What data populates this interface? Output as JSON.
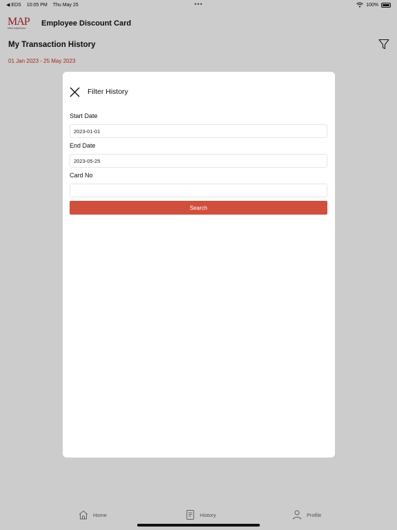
{
  "status_bar": {
    "back_label": "◀ EDS",
    "time": "10:05 PM",
    "date": "Thu May 25",
    "battery": "100%"
  },
  "header": {
    "logo_text": "MAP",
    "logo_subtext": "Mitra Adiperkasa",
    "app_title": "Employee Discount Card",
    "page_title": "My Transaction History",
    "date_range": "01 Jan 2023 - 25 May 2023"
  },
  "modal": {
    "title": "Filter History",
    "start_date_label": "Start Date",
    "start_date_value": "2023-01-01",
    "end_date_label": "End Date",
    "end_date_value": "2023-05-25",
    "card_no_label": "Card No",
    "card_no_value": "",
    "search_label": "Search"
  },
  "tabs": [
    {
      "label": "Home",
      "icon": "home-icon"
    },
    {
      "label": "History",
      "icon": "document-icon"
    },
    {
      "label": "Profile",
      "icon": "person-icon"
    }
  ],
  "colors": {
    "accent": "#d0503d",
    "date_range": "#c7352b",
    "logo": "#b5242a"
  }
}
